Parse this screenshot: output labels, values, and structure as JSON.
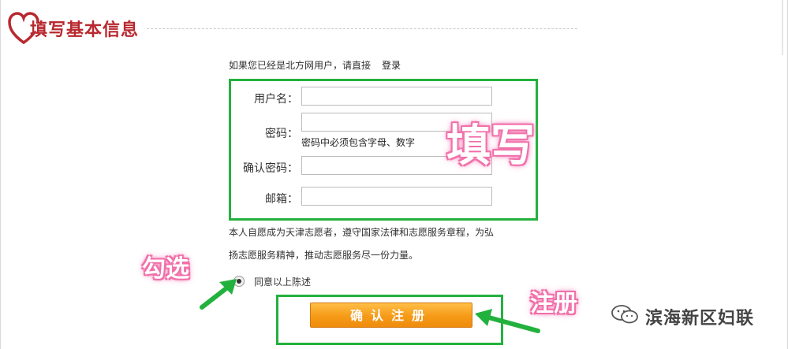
{
  "header": {
    "title": "填写基本信息",
    "logo_icon": "heart-icon",
    "logo_color": "#b8292f"
  },
  "login_prompt": {
    "text": "如果您已经是北方网用户，请直接",
    "link_label": "登录"
  },
  "form": {
    "fields": [
      {
        "label": "用户名：",
        "value": "",
        "placeholder": ""
      },
      {
        "label": "密码：",
        "value": "",
        "placeholder": ""
      },
      {
        "label": "确认密码：",
        "value": "",
        "placeholder": ""
      },
      {
        "label": "邮箱：",
        "value": "",
        "placeholder": ""
      }
    ],
    "password_hint": "密码中必须包含字母、数字"
  },
  "agreement": {
    "line1": "本人自愿成为天津志愿者，遵守国家法律和志愿服务章程，为弘",
    "line2": "扬志愿服务精神，推动志愿服务尽一份力量。",
    "checkbox_label": "同意以上陈述",
    "checked": true
  },
  "submit": {
    "label": "确认注册",
    "color": "#f59a17"
  },
  "annotations": {
    "fill": "填写",
    "check": "勾选",
    "register": "注册",
    "highlight_color": "#23b13e",
    "text_glow_color": "#f06aa6"
  },
  "watermark": {
    "text": "滨海新区妇联",
    "icon": "wechat-icon"
  }
}
